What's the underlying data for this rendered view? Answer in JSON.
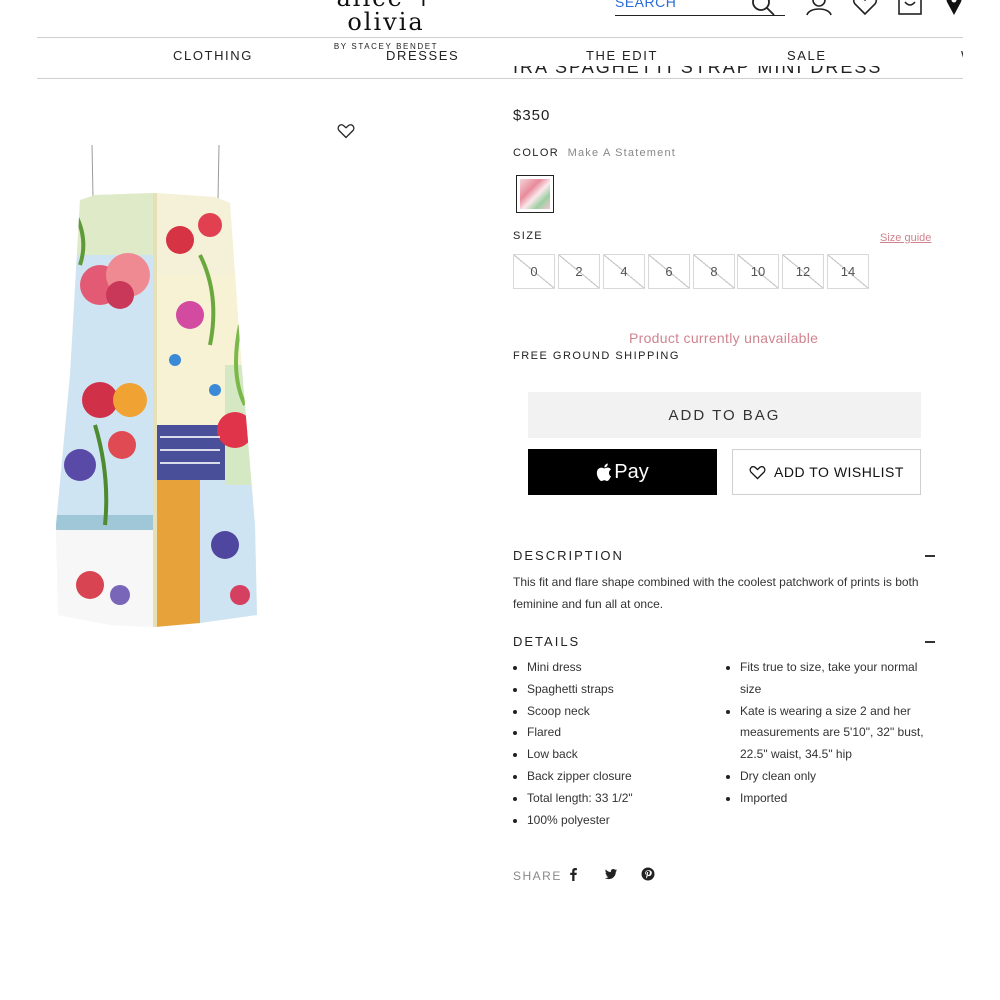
{
  "header": {
    "logo_main": "alice + olivia",
    "logo_sub": "BY STACEY BENDET",
    "search_placeholder": "SEARCH"
  },
  "nav": {
    "items": [
      "CLOTHING",
      "DRESSES",
      "THE EDIT",
      "SALE",
      "W"
    ]
  },
  "product": {
    "title": "IRA SPAGHETTI STRAP MINI DRESS",
    "price": "$350",
    "color_label": "COLOR",
    "color_value": "Make A Statement",
    "size_label": "SIZE",
    "size_guide": "Size guide",
    "sizes": [
      "0",
      "2",
      "4",
      "6",
      "8",
      "10",
      "12",
      "14"
    ],
    "unavailable": "Product currently unavailable",
    "shipping": "FREE GROUND SHIPPING",
    "add_to_bag": "ADD TO BAG",
    "apple_pay": "Pay",
    "add_to_wishlist": "ADD TO WISHLIST"
  },
  "description": {
    "heading": "DESCRIPTION",
    "text": "This fit and flare shape combined with the coolest patchwork of prints is both feminine and fun all at once."
  },
  "details": {
    "heading": "DETAILS",
    "left": [
      "Mini dress",
      "Spaghetti straps",
      "Scoop neck",
      "Flared",
      "Low back",
      "Back zipper closure",
      "Total length: 33 1/2\"",
      "100% polyester"
    ],
    "right": [
      "Fits true to size, take your normal size",
      "Kate is wearing a size 2 and her measurements are 5'10\", 32\" bust, 22.5\" waist, 34.5\" hip",
      "Dry clean only",
      "Imported"
    ]
  },
  "share": {
    "label": "SHARE",
    "icons": [
      "facebook-icon",
      "twitter-icon",
      "pinterest-icon"
    ]
  },
  "colors": {
    "accent_pink": "#d0848e",
    "search_blue": "#2a6bd6",
    "apple_pay_bg": "#000000"
  }
}
